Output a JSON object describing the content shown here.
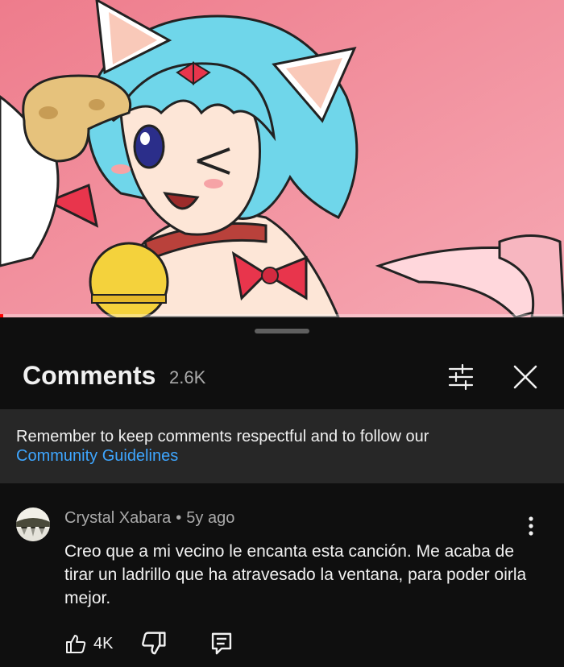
{
  "video": {
    "progress_fraction": 0.005,
    "background_color": "#f08a98",
    "hair_color": "#6fd6ea"
  },
  "comments_panel": {
    "title": "Comments",
    "count": "2.6K",
    "filter_icon": "sliders-icon",
    "close_icon": "close-icon"
  },
  "notice": {
    "text": "Remember to keep comments respectful and to follow our",
    "link": "Community Guidelines",
    "link_color": "#3ea6ff"
  },
  "comment": {
    "author": "Crystal Xabara",
    "separator": "•",
    "time": "5y ago",
    "text": "Creo que a mi vecino le encanta esta canción. Me acaba de tirar un ladrillo que ha atravesado la ventana, para poder oirla mejor.",
    "likes": "4K",
    "like_icon": "thumbs-up-icon",
    "dislike_icon": "thumbs-down-icon",
    "reply_icon": "reply-icon",
    "more_icon": "more-vertical-icon"
  }
}
